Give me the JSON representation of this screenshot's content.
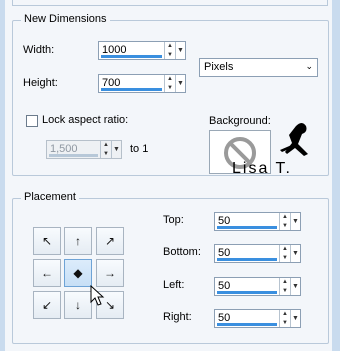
{
  "dimensions": {
    "title": "New Dimensions",
    "width_label": "Width:",
    "width_value": "1000",
    "height_label": "Height:",
    "height_value": "700",
    "units": "Pixels",
    "lock_label": "Lock aspect ratio:",
    "ratio_value": "1,500",
    "ratio_suffix": "to 1",
    "background_label": "Background:",
    "watermark_text": "Lisa T."
  },
  "placement": {
    "title": "Placement",
    "top_label": "Top:",
    "top_value": "50",
    "bottom_label": "Bottom:",
    "bottom_value": "50",
    "left_label": "Left:",
    "left_value": "50",
    "right_label": "Right:",
    "right_value": "50",
    "anchors": [
      "↖",
      "↑",
      "↗",
      "←",
      "◆",
      "→",
      "↙",
      "↓",
      "↘"
    ]
  },
  "colors": {
    "accent": "#3a8fdf",
    "panel": "#f3f6fa",
    "background": "#c9dbee"
  }
}
